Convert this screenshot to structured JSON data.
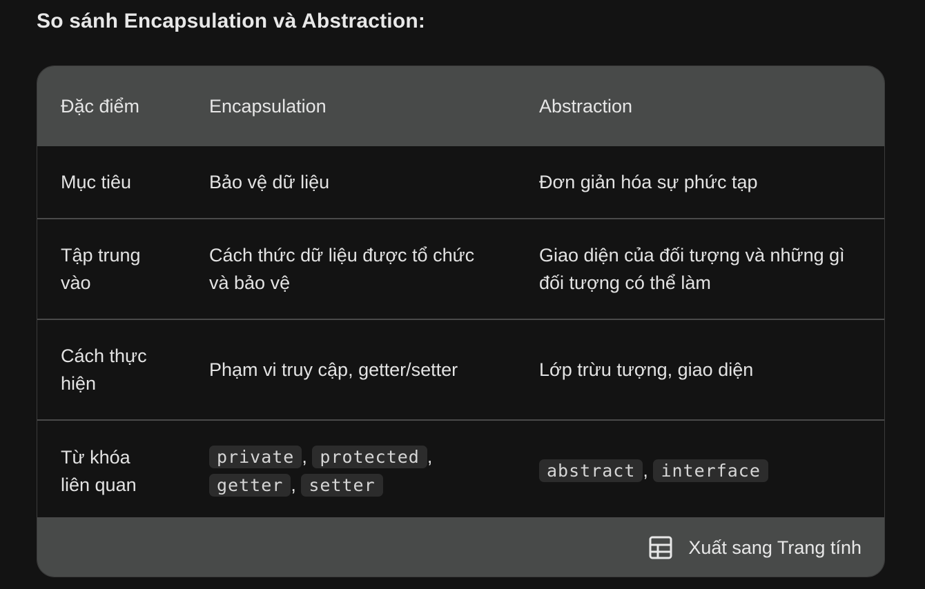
{
  "heading": "So sánh Encapsulation và Abstraction:",
  "table": {
    "headers": [
      "Đặc điểm",
      "Encapsulation",
      "Abstraction"
    ],
    "rows": [
      {
        "feature": "Mục tiêu",
        "encapsulation": "Bảo vệ dữ liệu",
        "abstraction": "Đơn giản hóa sự phức tạp"
      },
      {
        "feature": "Tập trung vào",
        "encapsulation": "Cách thức dữ liệu được tổ chức và bảo vệ",
        "abstraction": "Giao diện của đối tượng và những gì đối tượng có thể làm"
      },
      {
        "feature": "Cách thực hiện",
        "encapsulation": "Phạm vi truy cập, getter/setter",
        "abstraction": "Lớp trừu tượng, giao diện"
      },
      {
        "feature": "Từ khóa liên quan",
        "encapsulation_keywords": [
          "private",
          "protected",
          "getter",
          "setter"
        ],
        "abstraction_keywords": [
          "abstract",
          "interface"
        ],
        "separator": ","
      }
    ]
  },
  "footer": {
    "export_label": "Xuất sang Trang tính",
    "export_icon": "table-sheet-icon"
  },
  "colors": {
    "background": "#131313",
    "header_bg": "#484a49",
    "divider": "#4a4a4a",
    "code_bg": "#2c2c2c",
    "text": "#e3e3e3"
  }
}
